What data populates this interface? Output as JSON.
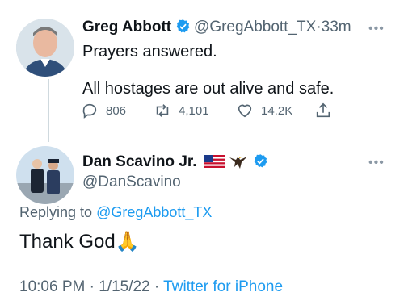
{
  "tweet1": {
    "display_name": "Greg Abbott",
    "handle": "@GregAbbott_TX",
    "separator": "·",
    "time": "33m",
    "line1": "Prayers answered.",
    "line2": "All hostages are out alive and safe.",
    "replies": "806",
    "retweets": "4,101",
    "likes": "14.2K",
    "avatar_icon": "user-photo-avatar"
  },
  "tweet2": {
    "display_name": "Dan Scavino Jr.",
    "handle": "@DanScavino",
    "replying_prefix": "Replying to",
    "replying_handle": "@GregAbbott_TX",
    "body": "Thank God",
    "emoji": "🙏",
    "time": "10:06 PM",
    "date": "1/15/22",
    "dot": "·",
    "source": "Twitter for iPhone",
    "flag_icon": "us-flag-icon",
    "eagle_icon": "eagle-icon"
  },
  "colors": {
    "accent": "#1d9bf0",
    "secondary_text": "#536471",
    "primary_text": "#0f1419"
  }
}
